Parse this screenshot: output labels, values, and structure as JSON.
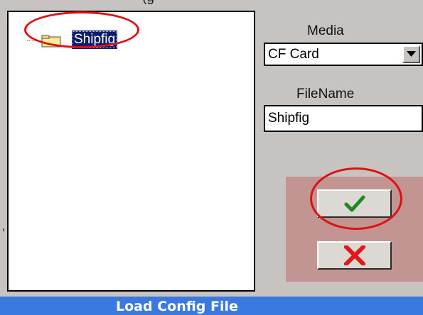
{
  "header": {
    "cropped_caption": "(g"
  },
  "tree": {
    "items": [
      {
        "label": "Shipfig",
        "icon": "folder-icon",
        "selected": true
      }
    ]
  },
  "media": {
    "label": "Media",
    "selected": "CF Card",
    "dropdown_icon": "chevron-down-icon"
  },
  "filename": {
    "label": "FileName",
    "value": "Shipfig"
  },
  "buttons": {
    "ok_icon": "checkmark-icon",
    "cancel_icon": "cross-icon"
  },
  "colors": {
    "panel_bg": "#c7c3c0",
    "button_area_bg": "#c29592",
    "title_bar": "#3a7ae0",
    "selection": "#0a1c6b",
    "annotation": "#dd1111",
    "check": "#1e8a1e",
    "cross": "#e01a1a"
  },
  "status_bar": {
    "title": "Load Config File"
  }
}
